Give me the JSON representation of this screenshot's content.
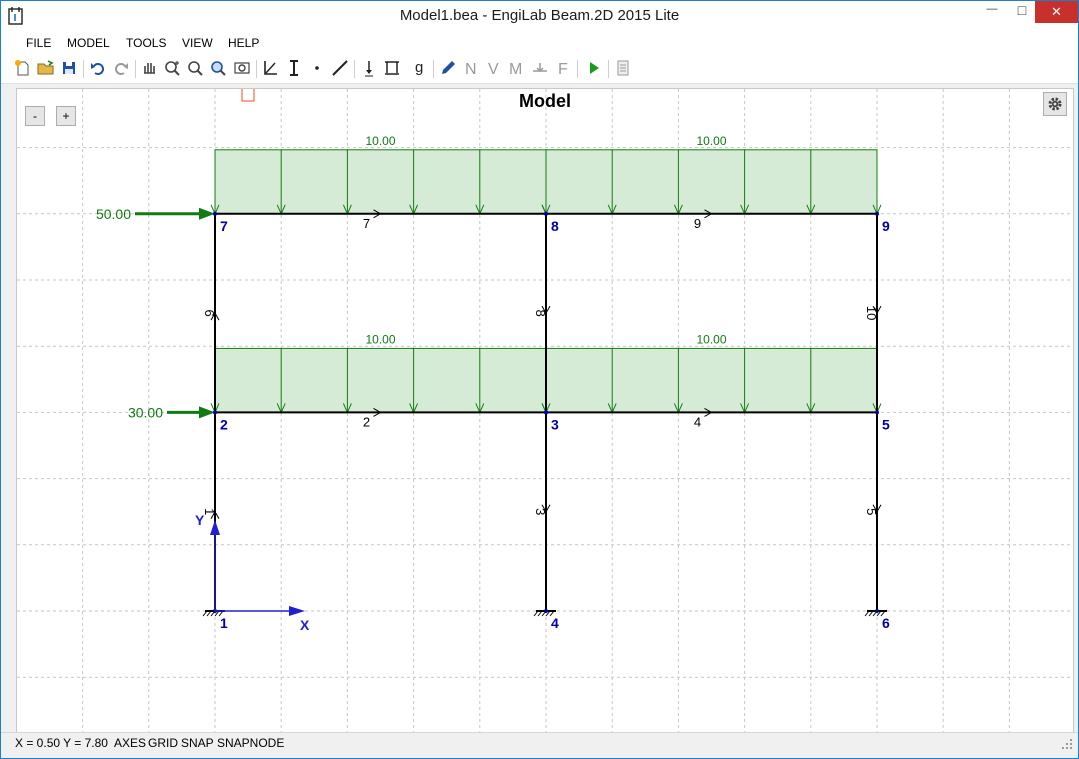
{
  "window": {
    "title": "Model1.bea - EngiLab Beam.2D 2015 Lite",
    "minimize_glyph": "—",
    "maximize_glyph": "□",
    "close_glyph": "✕"
  },
  "menu": {
    "file": "FILE",
    "model": "MODEL",
    "tools": "TOOLS",
    "view": "VIEW",
    "help": "HELP"
  },
  "toolbar": {
    "icons": [
      "new-file-icon",
      "open-file-icon",
      "save-icon",
      "undo-icon",
      "redo-icon",
      "pan-icon",
      "zoom-in-icon",
      "zoom-window-icon",
      "zoom-extents-icon",
      "zoom-previous-icon",
      "material-properties-icon",
      "section-properties-icon",
      "add-node-icon",
      "add-element-icon",
      "nodal-load-icon",
      "distributed-load-icon",
      "restraint-icon",
      "edit-icon",
      "axial-force-icon",
      "shear-force-icon",
      "bending-moment-icon",
      "deformed-shape-icon",
      "reactions-icon",
      "run-analysis-icon",
      "report-icon"
    ]
  },
  "canvas": {
    "title": "Model",
    "zoom_out_label": "-",
    "zoom_in_label": "+",
    "axis_x_label": "X",
    "axis_y_label": "Y"
  },
  "model": {
    "nodes": [
      {
        "id": "1",
        "x": 0,
        "y": 0
      },
      {
        "id": "2",
        "x": 0,
        "y": 3
      },
      {
        "id": "3",
        "x": 5,
        "y": 3
      },
      {
        "id": "4",
        "x": 5,
        "y": 0
      },
      {
        "id": "5",
        "x": 10,
        "y": 3
      },
      {
        "id": "6",
        "x": 10,
        "y": 0
      },
      {
        "id": "7",
        "x": 0,
        "y": 6
      },
      {
        "id": "8",
        "x": 5,
        "y": 6
      },
      {
        "id": "9",
        "x": 10,
        "y": 6
      }
    ],
    "elements": [
      {
        "id": "1",
        "n1": "1",
        "n2": "2"
      },
      {
        "id": "2",
        "n1": "2",
        "n2": "3"
      },
      {
        "id": "3",
        "n1": "3",
        "n2": "4"
      },
      {
        "id": "4",
        "n1": "3",
        "n2": "5"
      },
      {
        "id": "5",
        "n1": "5",
        "n2": "6"
      },
      {
        "id": "6",
        "n1": "2",
        "n2": "7"
      },
      {
        "id": "7",
        "n1": "7",
        "n2": "8"
      },
      {
        "id": "8",
        "n1": "8",
        "n2": "3"
      },
      {
        "id": "9",
        "n1": "8",
        "n2": "9"
      },
      {
        "id": "10",
        "n1": "9",
        "n2": "5"
      }
    ],
    "supports": [
      "1",
      "4",
      "6"
    ],
    "nodal_loads": [
      {
        "node": "7",
        "label": "50.00"
      },
      {
        "node": "2",
        "label": "30.00"
      }
    ],
    "distributed_loads": [
      {
        "element": "7",
        "label": "10.00"
      },
      {
        "element": "9",
        "label": "10.00"
      },
      {
        "element": "2",
        "label": "10.00"
      },
      {
        "element": "4",
        "label": "10.00"
      }
    ],
    "colors": {
      "node": "#0000a8",
      "element": "#000000",
      "load": "#127a12",
      "load_fill": "#d5ebd5",
      "grid": "#c6c6c6",
      "axes": "#2020d0"
    }
  },
  "status": {
    "coords": "X = 0.50  Y = 7.80",
    "axes": "AXES",
    "grid": "GRID",
    "snap": "SNAP",
    "snapnode": "SNAPNODE"
  }
}
